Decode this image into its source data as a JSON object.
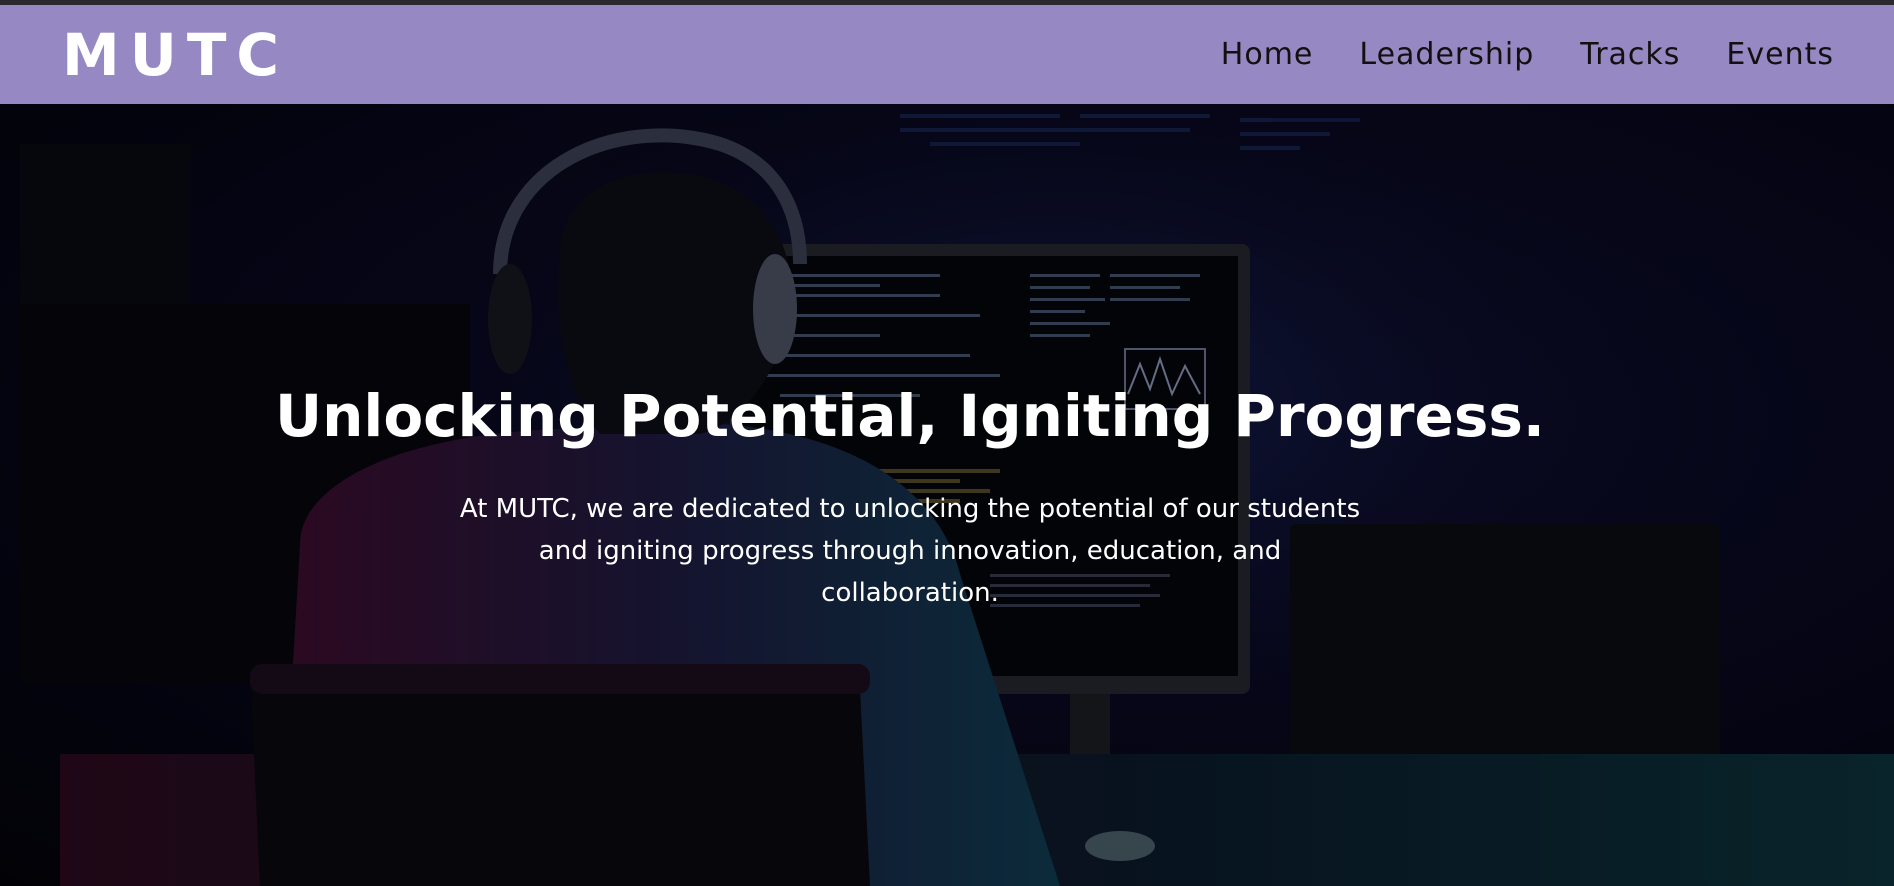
{
  "header": {
    "logo": "MUTC",
    "nav": [
      {
        "label": "Home"
      },
      {
        "label": "Leadership"
      },
      {
        "label": "Tracks"
      },
      {
        "label": "Events"
      }
    ],
    "colors": {
      "background": "#9688c2",
      "logo": "#ffffff",
      "link": "#111111"
    }
  },
  "hero": {
    "title": "Unlocking Potential, Igniting Progress.",
    "subtitle": "At MUTC, we are dedicated to unlocking the potential of our students and igniting progress through innovation, education, and collaboration.",
    "background_image": "developer-with-headphones-at-monitor-photo"
  }
}
